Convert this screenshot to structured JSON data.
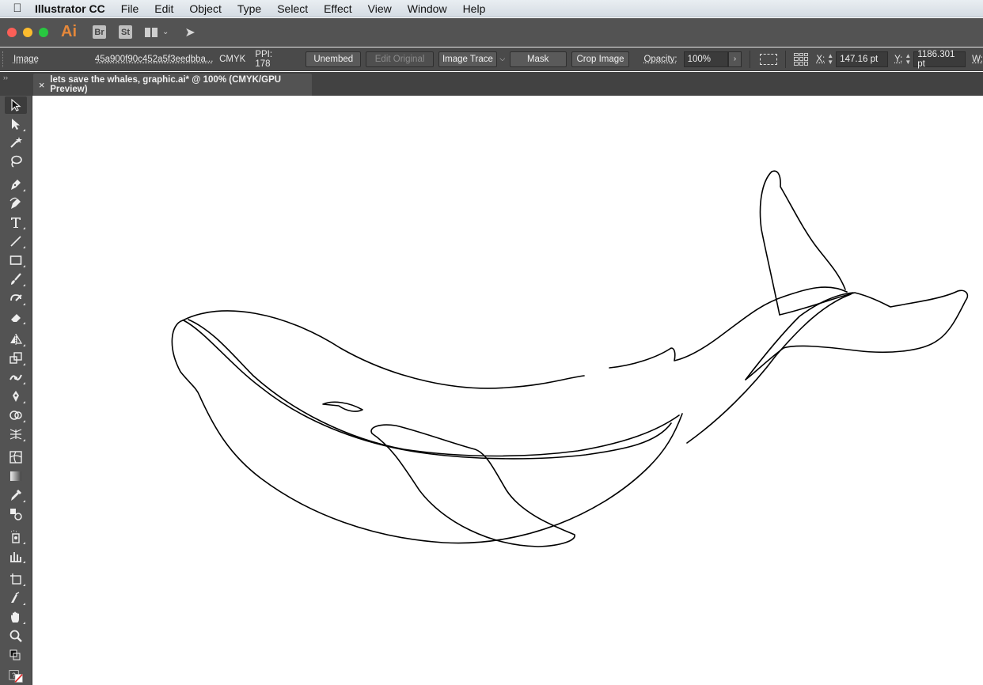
{
  "menubar": {
    "app_name": "Illustrator CC",
    "menus": [
      "File",
      "Edit",
      "Object",
      "Type",
      "Select",
      "Effect",
      "View",
      "Window",
      "Help"
    ]
  },
  "appbar": {
    "logo": "Ai",
    "bridge": "Br",
    "stock": "St"
  },
  "controlbar": {
    "selection_type": "Image",
    "filename": "45a900f90c452a5f3eedbba...",
    "color_mode": "CMYK",
    "ppi": "PPI: 178",
    "unembed": "Unembed",
    "edit_original": "Edit Original",
    "image_trace": "Image Trace",
    "mask": "Mask",
    "crop_image": "Crop Image",
    "opacity_label": "Opacity:",
    "opacity_value": "100%",
    "x_label": "X:",
    "x_value": "147.16 pt",
    "y_label": "Y:",
    "y_value": "1186.301 pt",
    "w_label": "W:"
  },
  "document": {
    "tab_title": "lets save the whales, graphic.ai* @ 100% (CMYK/GPU Preview)",
    "close_glyph": "×"
  },
  "tools_panel": {
    "collapse_glyph": "››",
    "tools": [
      "selection-tool",
      "direct-selection-tool",
      "magic-wand-tool",
      "lasso-tool",
      "pen-tool",
      "curvature-tool",
      "type-tool",
      "line-segment-tool",
      "rectangle-tool",
      "paintbrush-tool",
      "shaper-tool",
      "eraser-tool",
      "rotate-tool",
      "scale-tool",
      "width-tool",
      "puppet-warp-tool",
      "shape-builder-tool",
      "perspective-grid-tool",
      "mesh-tool",
      "gradient-tool",
      "eyedropper-tool",
      "blend-tool",
      "symbol-sprayer-tool",
      "column-graph-tool",
      "artboard-tool",
      "slice-tool",
      "hand-tool",
      "zoom-tool"
    ]
  },
  "colors": {
    "menubar": "#dfe5ea",
    "appbar": "#535353",
    "controlbar": "#4a4a4a",
    "canvas": "#ffffff",
    "artwork_stroke": "#000000",
    "ai_logo": "#e6883a"
  }
}
